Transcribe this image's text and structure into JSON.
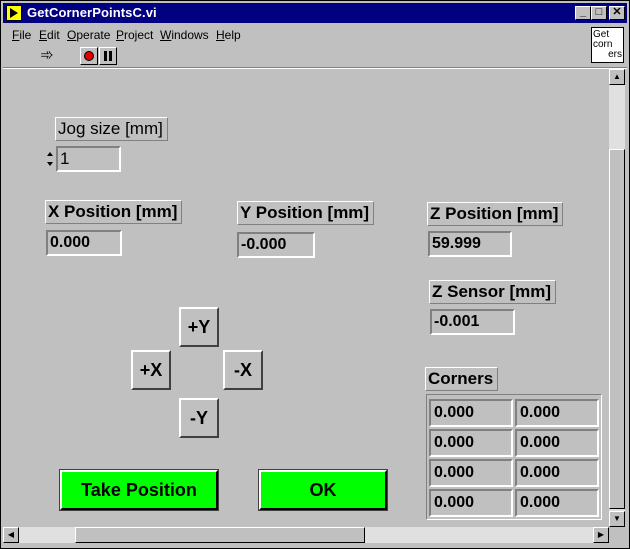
{
  "window": {
    "title": "GetCornerPointsC.vi"
  },
  "titlebar_buttons": {
    "minimize": "_",
    "maximize": "□",
    "close": "✕"
  },
  "menu": [
    {
      "label": "File",
      "key": "F",
      "rest": "ile"
    },
    {
      "label": "Edit",
      "key": "E",
      "rest": "dit"
    },
    {
      "label": "Operate",
      "key": "O",
      "rest": "perate"
    },
    {
      "label": "Project",
      "key": "P",
      "rest": "roject"
    },
    {
      "label": "Windows",
      "key": "W",
      "rest": "indows"
    },
    {
      "label": "Help",
      "key": "H",
      "rest": "elp"
    }
  ],
  "toolbar": {
    "run_icon": "run-arrow-icon",
    "run_glyph": "➾"
  },
  "vi_icon": {
    "line1": "Get",
    "line2": "corn",
    "line3": "ers"
  },
  "jog": {
    "label": "Jog size [mm]",
    "value": "1"
  },
  "x_position": {
    "label": "X Position [mm]",
    "value": "0.000"
  },
  "y_position": {
    "label": "Y Position [mm]",
    "value": "-0.000"
  },
  "z_position": {
    "label": "Z Position [mm]",
    "value": "59.999"
  },
  "z_sensor": {
    "label": "Z Sensor [mm]",
    "value": "-0.001"
  },
  "jog_buttons": {
    "plus_y": "+Y",
    "minus_y": "-Y",
    "plus_x": "+X",
    "minus_x": "-X"
  },
  "corners": {
    "label": "Corners",
    "rows": [
      [
        "0.000",
        "0.000"
      ],
      [
        "0.000",
        "0.000"
      ],
      [
        "0.000",
        "0.000"
      ],
      [
        "0.000",
        "0.000"
      ]
    ]
  },
  "buttons": {
    "take_position": "Take Position",
    "ok": "OK"
  },
  "colors": {
    "title_bg": "#000080",
    "panel_bg": "#c0c0c0",
    "button_green": "#00ff00",
    "stop_red": "#e00000"
  }
}
